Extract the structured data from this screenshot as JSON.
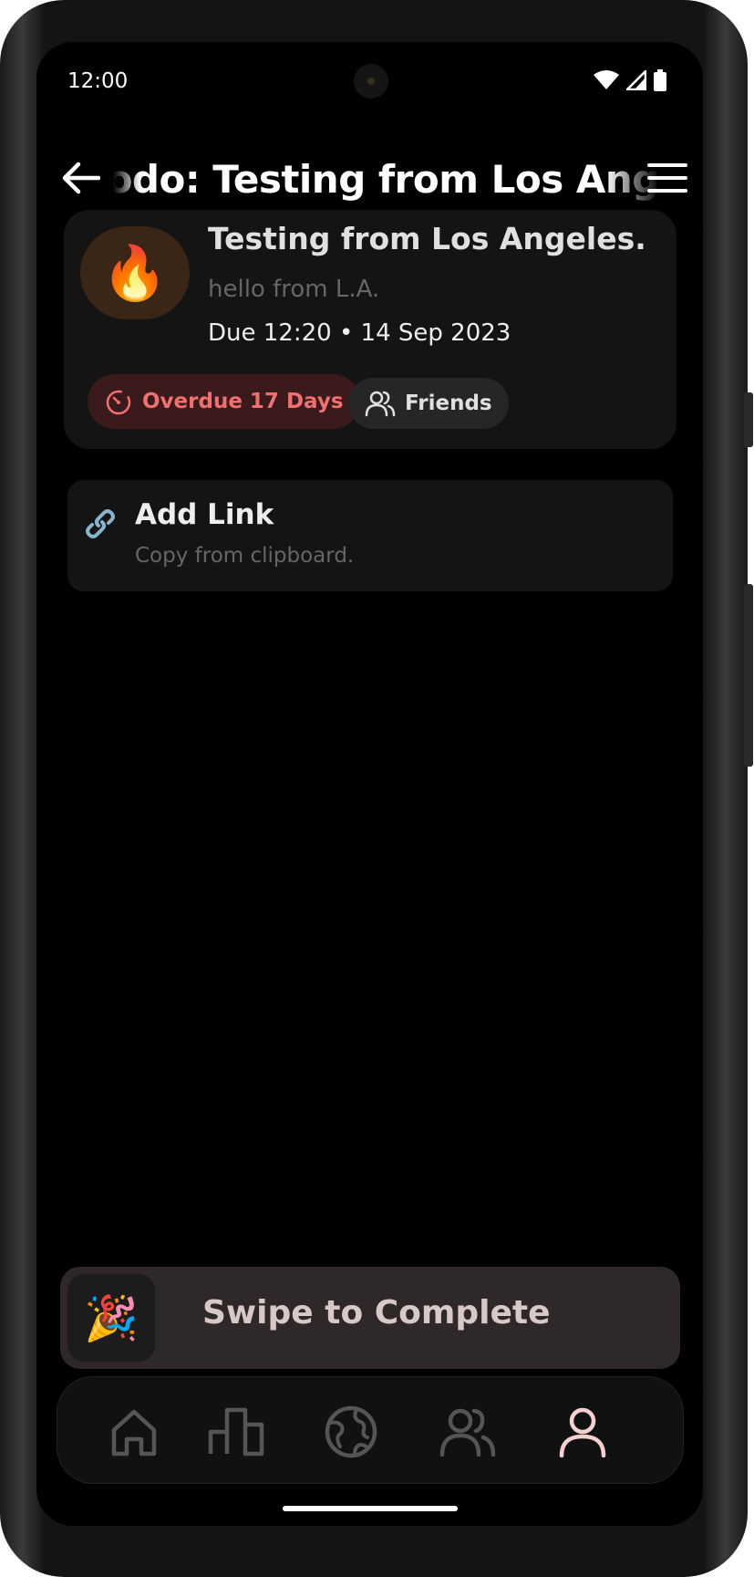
{
  "status_bar": {
    "time": "12:00"
  },
  "app_bar": {
    "title": "Todo: Testing from Los Angeles."
  },
  "task": {
    "emoji": "🔥",
    "title": "Testing from Los Angeles.",
    "description": "hello from L.A.",
    "due": "Due 12:20 • 14 Sep 2023",
    "overdue_label": "Overdue 17 Days",
    "visibility_label": "Friends"
  },
  "link_card": {
    "title": "Add Link",
    "subtitle": "Copy from clipboard."
  },
  "swipe": {
    "emoji": "🎉",
    "label": "Swipe to Complete"
  },
  "bottom_nav": {
    "items": [
      {
        "icon": "home-icon"
      },
      {
        "icon": "leaderboard-icon"
      },
      {
        "icon": "globe-icon"
      },
      {
        "icon": "friends-icon"
      },
      {
        "icon": "profile-icon",
        "active": true
      }
    ]
  },
  "colors": {
    "overdue": "#f07070",
    "active_nav": "#f5d0d0",
    "inactive_nav": "#555555"
  }
}
